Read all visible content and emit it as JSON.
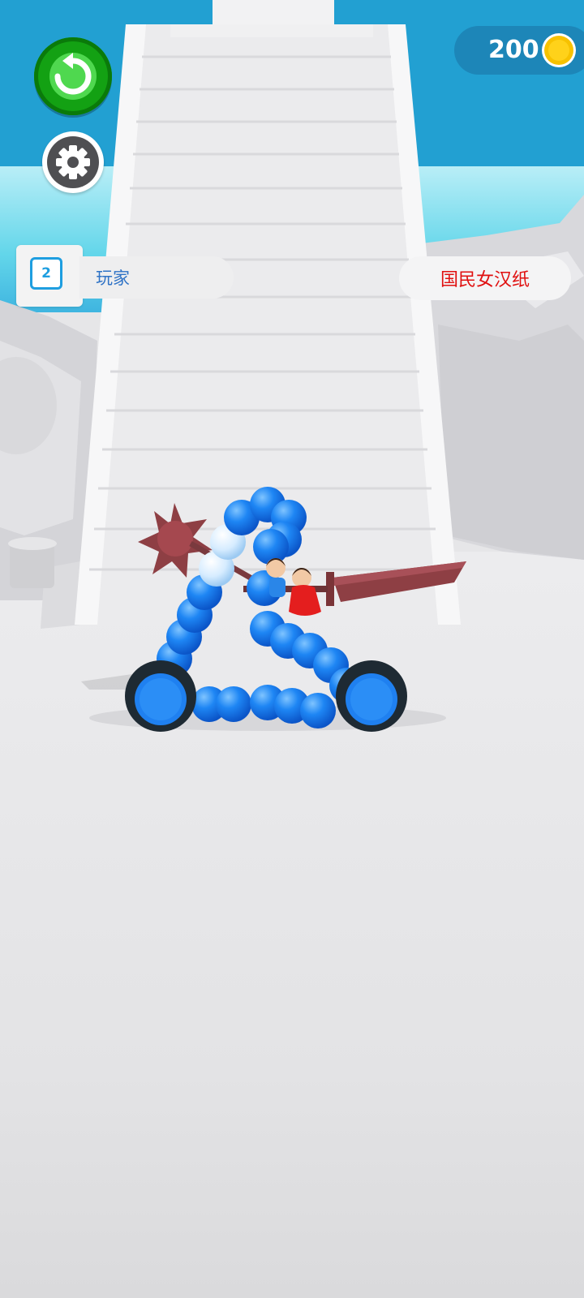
{
  "hud": {
    "coins": "200",
    "restart_icon": "restart-arrow-icon",
    "settings_icon": "gear-icon",
    "coin_icon": "gold-coin-icon"
  },
  "race": {
    "player": {
      "rank": "2",
      "name": "玩家"
    },
    "opponent": {
      "name": "国民女汉纸"
    }
  },
  "colors": {
    "sky": "#22a0d2",
    "restart_button": "#13a113",
    "coin": "#f7c200",
    "player_name": "#2f73c6",
    "opponent_name": "#e01010",
    "vehicle_blue": "#1d7ff2",
    "weapon": "#8e3f44"
  }
}
